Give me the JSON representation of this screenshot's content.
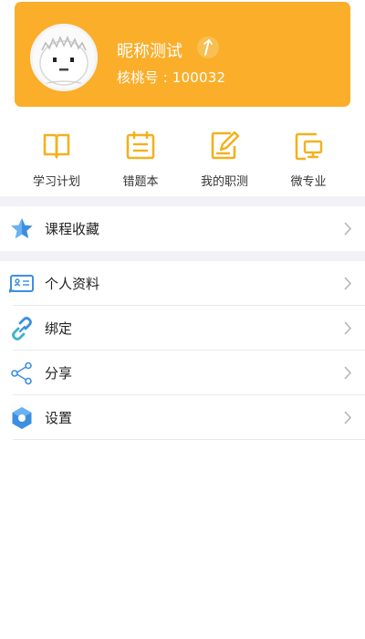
{
  "profile": {
    "nickname": "昵称测试",
    "account_id": "核桃号 : 100032",
    "card_color": "#FBAE2A"
  },
  "quick_actions": [
    {
      "label": "学习计划",
      "icon": "book-icon"
    },
    {
      "label": "错题本",
      "icon": "notebook-icon"
    },
    {
      "label": "我的职测",
      "icon": "edit-document-icon"
    },
    {
      "label": "微专业",
      "icon": "monitor-icon"
    }
  ],
  "menu": {
    "favorites": {
      "label": "课程收藏",
      "icon": "star-icon"
    },
    "items": [
      {
        "label": "个人资料",
        "icon": "id-card-icon"
      },
      {
        "label": "绑定",
        "icon": "link-icon"
      },
      {
        "label": "分享",
        "icon": "share-icon"
      },
      {
        "label": "设置",
        "icon": "settings-hex-icon"
      }
    ]
  },
  "colors": {
    "accent": "#FBAE2A",
    "icon_yellow": "#F3B11E",
    "icon_blue": "#3C8FE0",
    "section_gap": "#F2F2F6"
  }
}
